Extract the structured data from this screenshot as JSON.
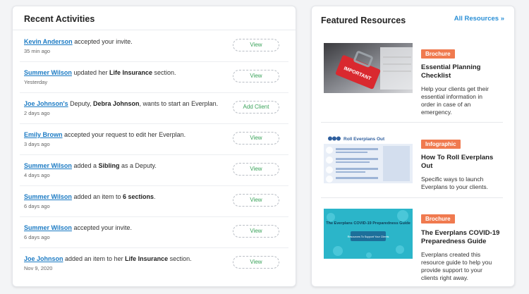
{
  "activities": {
    "title": "Recent Activities",
    "items": [
      {
        "user": "Kevin Anderson",
        "t1": " accepted your invite.",
        "b1": "",
        "t2": "",
        "b2": "",
        "t3": "",
        "time": "35 min ago",
        "button": "View"
      },
      {
        "user": "Summer Wilson",
        "t1": " updated her ",
        "b1": "Life Insurance",
        "t2": " section.",
        "b2": "",
        "t3": "",
        "time": "Yesterday",
        "button": "View"
      },
      {
        "user": "Joe Johnson's",
        "t1": " Deputy, ",
        "b1": "Debra Johnson",
        "t2": ", wants to start an Everplan.",
        "b2": "",
        "t3": "",
        "time": "2 days ago",
        "button": "Add Client"
      },
      {
        "user": "Emily Brown",
        "t1": " accepted your request to edit her Everplan.",
        "b1": "",
        "t2": "",
        "b2": "",
        "t3": "",
        "time": "3 days ago",
        "button": "View"
      },
      {
        "user": "Summer Wilson",
        "t1": " added a ",
        "b1": "Sibling",
        "t2": " as a Deputy.",
        "b2": "",
        "t3": "",
        "time": "4 days ago",
        "button": "View"
      },
      {
        "user": "Summer Wilson",
        "t1": " added an item to ",
        "b1": "6 sections",
        "t2": ".",
        "b2": "",
        "t3": "",
        "time": "6 days ago",
        "button": "View"
      },
      {
        "user": "Summer Wilson",
        "t1": " accepted your invite.",
        "b1": "",
        "t2": "",
        "b2": "",
        "t3": "",
        "time": "6 days ago",
        "button": "View"
      },
      {
        "user": "Joe Johnson",
        "t1": " added an item to her ",
        "b1": "Life Insurance",
        "t2": " section.",
        "b2": "",
        "t3": "",
        "time": "Nov 9, 2020",
        "button": "View"
      }
    ]
  },
  "resources": {
    "title": "Featured Resources",
    "all_link": "All Resources »",
    "items": [
      {
        "badge": "Brochure",
        "title_lines": [
          "Essential Planning",
          "Checklist"
        ],
        "desc_lines": [
          "Help your clients get their",
          "essential information in",
          "order in case of an",
          "emergency."
        ],
        "thumb_text": "IMPORTANT",
        "accent": "#d9292f"
      },
      {
        "badge": "Infographic",
        "title_lines": [
          "How To Roll Everplans",
          "Out"
        ],
        "desc_lines": [
          "Specific ways to launch",
          "Everplans to your clients."
        ],
        "thumb_text": "Roll Everplans Out",
        "accent": "#2f5f9e"
      },
      {
        "badge": "Brochure",
        "title_lines": [
          "The Everplans COVID-19",
          "Preparedness Guide"
        ],
        "desc_lines": [
          "Everplans created this",
          "resource guide to help you",
          "provide support to your",
          "clients right away."
        ],
        "thumb_text": "The Everplans COVID-19 Preparedness Guide",
        "thumb_sub": "Resources To Support Your Clients",
        "accent": "#2bb5c9"
      }
    ]
  }
}
